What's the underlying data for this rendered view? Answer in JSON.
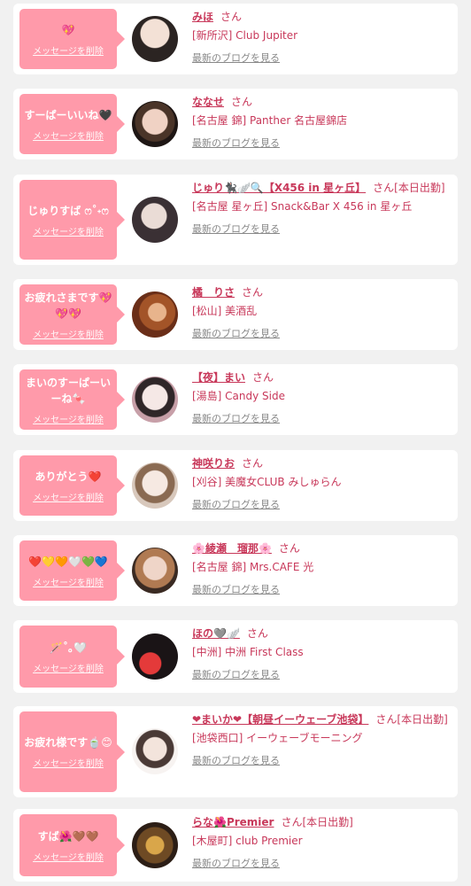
{
  "delete_label": "メッセージを削除",
  "honorific": "さん",
  "blog_label": "最新のブログを見る",
  "entries": [
    {
      "message": "💖",
      "name": "みほ",
      "status": "",
      "shop": "[新所沢] Club Jupiter"
    },
    {
      "message": "すーぱーいいね🖤",
      "name": "ななせ",
      "status": "",
      "shop": "[名古屋 錦] Panther 名古屋錦店"
    },
    {
      "message": "じゅりすば ෆ˚˖ෆ",
      "name": "じゅり🐈‍⬛🪽🔍【X456 in 星ヶ丘】",
      "status": "[本日出勤]",
      "shop": "[名古屋 星ヶ丘] Snack&Bar X 456 in 星ヶ丘"
    },
    {
      "message": "お疲れさまです💖💖💖",
      "name": "橘　りさ",
      "status": "",
      "shop": "[松山] 美酒乱"
    },
    {
      "message": "まいのすーぱーいーね🍬",
      "name": "【夜】まい",
      "status": "",
      "shop": "[湯島] Candy Side"
    },
    {
      "message": "ありがとう❤️",
      "name": "神咲りお",
      "status": "",
      "shop": "[刈谷] 美魔女CLUB みしゅらん"
    },
    {
      "message": "❤️💛🧡🤍💚💙",
      "name": "🌸綾瀬　瑠那🌸",
      "status": "",
      "shop": "[名古屋 錦] Mrs.CAFE 光"
    },
    {
      "message": "🪄˚｡🤍",
      "name": "ほの🩶🪽",
      "status": "",
      "shop": "[中洲] 中洲 First Class"
    },
    {
      "message": "お疲れ様です🍵😊",
      "name": "❤まいか❤【朝昼イーウェーブ池袋】",
      "status": "[本日出勤]",
      "shop": "[池袋西口] イーウェーブモーニング"
    },
    {
      "message": "すば🌺🤎🤎",
      "name": "らな🌺Premier",
      "status": "[本日出勤]",
      "shop": "[木屋町] club Premier"
    }
  ]
}
